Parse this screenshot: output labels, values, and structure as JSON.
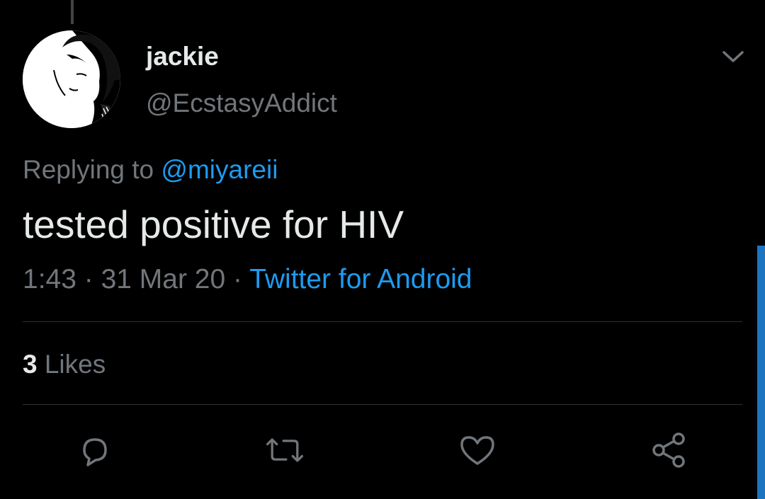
{
  "tweet": {
    "display_name": "jackie",
    "handle": "@EcstasyAddict",
    "replying_prefix": "Replying to",
    "replying_to": "@miyareii",
    "text": "tested positive for HIV",
    "time": "1:43",
    "date": "31 Mar 20",
    "separator": "·",
    "source": "Twitter for Android",
    "likes_count": "3",
    "likes_label": "Likes"
  },
  "icons": {
    "menu": "chevron-down-icon",
    "reply": "reply-icon",
    "retweet": "retweet-icon",
    "like": "heart-icon",
    "share": "share-icon"
  },
  "colors": {
    "background": "#000000",
    "primary_text": "#e6e9ea",
    "secondary_text": "#71767b",
    "link": "#1d9bf0",
    "divider": "#2f3336"
  }
}
